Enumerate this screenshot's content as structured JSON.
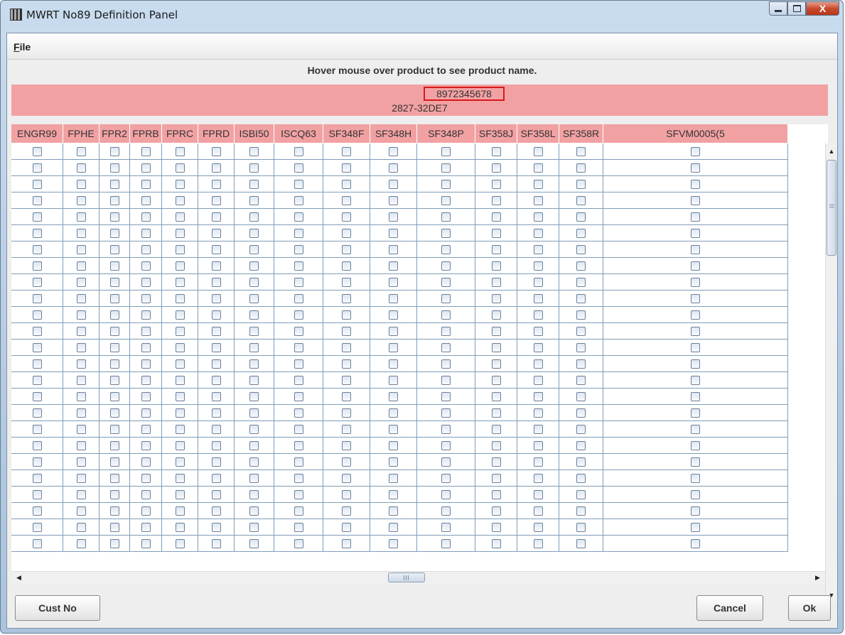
{
  "window": {
    "title": "MWRT No89 Definition Panel",
    "close_label": "X"
  },
  "menu": {
    "file_mnemonic": "F",
    "file_rest": "ile"
  },
  "hint": "Hover mouse over product to see product name.",
  "product": {
    "id": "8972345678",
    "code": "2827-32DE7"
  },
  "table": {
    "columns": [
      "ENGR99",
      "FPHE",
      "FPR2",
      "FPRB",
      "FPRC",
      "FPRD",
      "ISBI50",
      "ISCQ63",
      "SF348F",
      "SF348H",
      "SF348P",
      "SF358J",
      "SF358L",
      "SF358R",
      "SFVM0005(5"
    ],
    "visible_rows": 25,
    "checked": false
  },
  "buttons": {
    "cust_no": "Cust No",
    "cancel": "Cancel",
    "ok": "Ok"
  },
  "colors": {
    "header_bg": "#f2a1a3",
    "highlight_border": "#d8191c",
    "grid_line": "#7f9db9"
  }
}
